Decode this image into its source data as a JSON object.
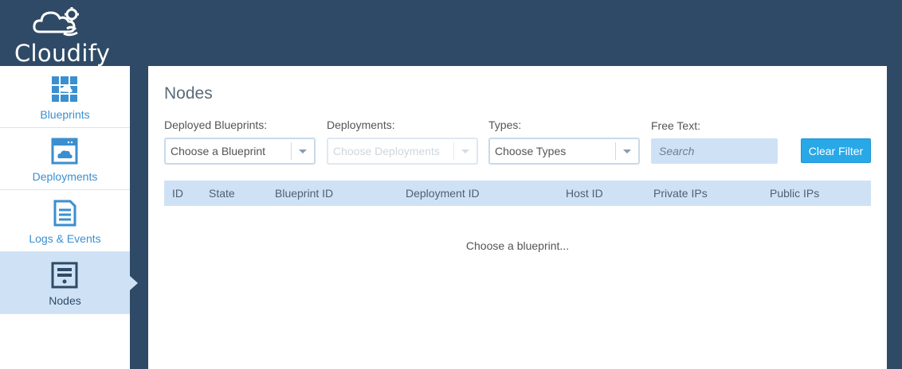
{
  "brand": {
    "name": "Cloudify"
  },
  "sidebar": {
    "items": [
      {
        "label": "Blueprints",
        "icon": "blueprint-icon"
      },
      {
        "label": "Deployments",
        "icon": "deployment-icon"
      },
      {
        "label": "Logs & Events",
        "icon": "logs-icon"
      },
      {
        "label": "Nodes",
        "icon": "nodes-icon",
        "active": true
      }
    ]
  },
  "page": {
    "title": "Nodes"
  },
  "filters": {
    "blueprints": {
      "label": "Deployed Blueprints:",
      "value": "Choose a Blueprint"
    },
    "deployments": {
      "label": "Deployments:",
      "value": "Choose Deployments",
      "disabled": true
    },
    "types": {
      "label": "Types:",
      "value": "Choose Types"
    },
    "free_text": {
      "label": "Free Text:",
      "placeholder": "Search"
    },
    "clear_label": "Clear Filter"
  },
  "table": {
    "columns": [
      "ID",
      "State",
      "Blueprint ID",
      "Deployment ID",
      "Host ID",
      "Private IPs",
      "Public IPs"
    ],
    "empty_message": "Choose a blueprint..."
  },
  "colors": {
    "topbar": "#2e4a66",
    "accent": "#29a8e8",
    "active_nav": "#cfe2f5",
    "nav_text": "#3a8fd0"
  }
}
